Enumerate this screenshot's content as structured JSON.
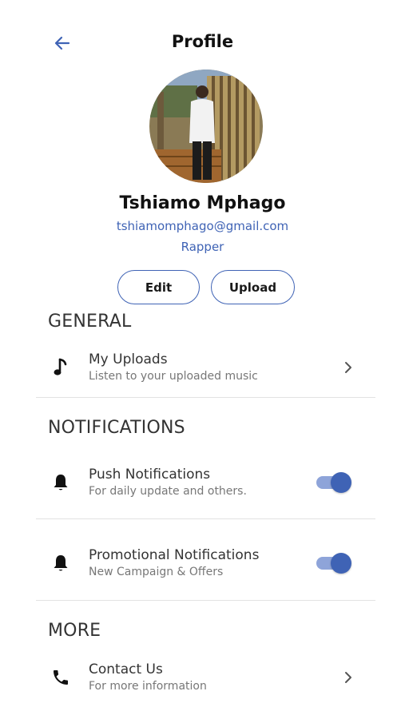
{
  "header": {
    "title": "Profile",
    "back_icon": "arrow-left-icon"
  },
  "profile": {
    "name": "Tshiamo Mphago",
    "email": "tshiamomphago@gmail.com",
    "role": "Rapper"
  },
  "actions": {
    "edit_label": "Edit",
    "upload_label": "Upload"
  },
  "sections": {
    "general": {
      "title": "GENERAL",
      "items": [
        {
          "title": "My Uploads",
          "subtitle": "Listen to your uploaded music",
          "icon": "music-note-icon"
        }
      ]
    },
    "notifications": {
      "title": "NOTIFICATIONS",
      "items": [
        {
          "title": "Push Notifications",
          "subtitle": "For daily update and others.",
          "icon": "bell-icon",
          "enabled": true
        },
        {
          "title": "Promotional Notifications",
          "subtitle": "New Campaign & Offers",
          "icon": "bell-icon",
          "enabled": true
        }
      ]
    },
    "more": {
      "title": "MORE",
      "items": [
        {
          "title": "Contact Us",
          "subtitle": "For more information",
          "icon": "phone-icon"
        }
      ]
    }
  },
  "colors": {
    "accent": "#3f63b5",
    "toggle_track": "#8ea4d9"
  }
}
